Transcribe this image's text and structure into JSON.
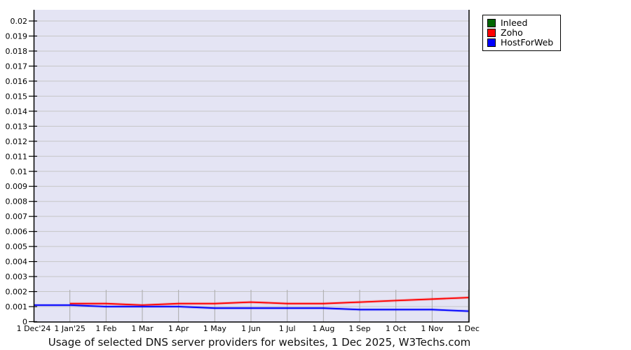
{
  "chart_data": {
    "type": "line",
    "title": "Usage of selected DNS server providers for websites, 1 Dec 2025, W3Techs.com",
    "x_tick_labels": [
      "1 Dec'24",
      "1 Jan'25",
      "1 Feb",
      "1 Mar",
      "1 Apr",
      "1 May",
      "1 Jun",
      "1 Jul",
      "1 Aug",
      "1 Sep",
      "1 Oct",
      "1 Nov",
      "1 Dec"
    ],
    "y_tick_labels": [
      "0",
      "0.001",
      "0.002",
      "0.003",
      "0.004",
      "0.005",
      "0.006",
      "0.007",
      "0.008",
      "0.009",
      "0.01",
      "0.011",
      "0.012",
      "0.013",
      "0.014",
      "0.015",
      "0.016",
      "0.017",
      "0.018",
      "0.019",
      "0.02"
    ],
    "ylim": [
      0,
      0.02
    ],
    "y_tick_step": 0.001,
    "grid": {
      "horizontal_gridlines": true,
      "vertical_month_ticklines": true
    },
    "legend_position": "top-right-outside",
    "series": [
      {
        "name": "Inleed",
        "color": "#006600",
        "start_index": 0,
        "values": [],
        "visible_in_plot": false
      },
      {
        "name": "Zoho",
        "color": "#ff0000",
        "start_index": 1,
        "values": [
          0.0012,
          0.0012,
          0.0011,
          0.0012,
          0.0012,
          0.0013,
          0.0012,
          0.0012,
          0.0013,
          0.0014,
          0.0015,
          0.0016
        ],
        "visible_in_plot": true
      },
      {
        "name": "HostForWeb",
        "color": "#0000ff",
        "start_index": 0,
        "values": [
          0.0011,
          0.0011,
          0.001,
          0.001,
          0.001,
          0.0009,
          0.0009,
          0.0009,
          0.0009,
          0.0008,
          0.0008,
          0.0008,
          0.0007
        ],
        "visible_in_plot": true
      }
    ],
    "colors": {
      "plot_background": "#e4e4f4",
      "horizontal_gridline": "#c6c6c6",
      "vertical_tickline": "#aaaaaa",
      "axis": "#000000",
      "legend_border": "#000000",
      "legend_background": "#ffffff"
    }
  }
}
